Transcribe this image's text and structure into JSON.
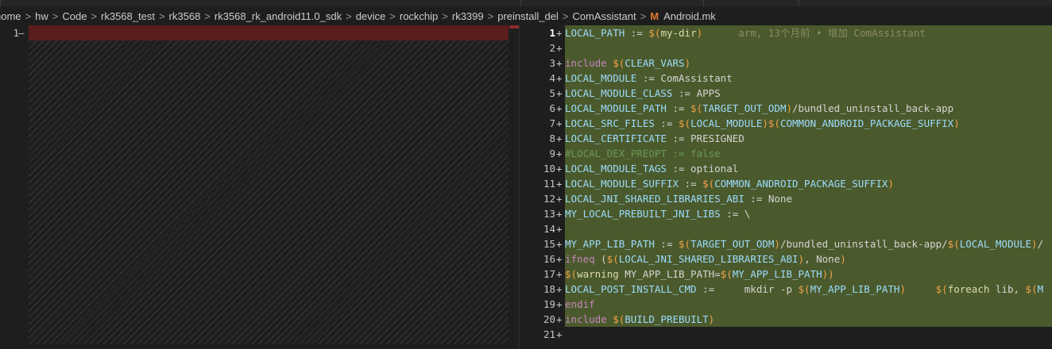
{
  "breadcrumb": {
    "items": [
      "home",
      "hw",
      "Code",
      "rk3568_test",
      "rk3568",
      "rk3568_rk_android11.0_sdk",
      "device",
      "rockchip",
      "rk3399",
      "preinstall_del",
      "ComAssistant"
    ],
    "file_icon": "M",
    "file_name": "Android.mk",
    "separator": ">"
  },
  "left": {
    "line_number": "1",
    "marker": "—"
  },
  "right": {
    "blame": "arm, 13个月前 • 增加 ComAssistant",
    "line_numbers": [
      "1",
      "2",
      "3",
      "4",
      "5",
      "6",
      "7",
      "8",
      "9",
      "10",
      "11",
      "12",
      "13",
      "14",
      "15",
      "16",
      "17",
      "18",
      "19",
      "20",
      "21"
    ],
    "plus": "+",
    "lines": [
      "LOCAL_PATH := $(my-dir)",
      "",
      "include $(CLEAR_VARS)",
      "LOCAL_MODULE := ComAssistant",
      "LOCAL_MODULE_CLASS := APPS",
      "LOCAL_MODULE_PATH := $(TARGET_OUT_ODM)/bundled_uninstall_back-app",
      "LOCAL_SRC_FILES := $(LOCAL_MODULE)$(COMMON_ANDROID_PACKAGE_SUFFIX)",
      "LOCAL_CERTIFICATE := PRESIGNED",
      "#LOCAL_DEX_PREOPT := false",
      "LOCAL_MODULE_TAGS := optional",
      "LOCAL_MODULE_SUFFIX := $(COMMON_ANDROID_PACKAGE_SUFFIX)",
      "LOCAL_JNI_SHARED_LIBRARIES_ABI := None",
      "MY_LOCAL_PREBUILT_JNI_LIBS := \\",
      "",
      "MY_APP_LIB_PATH := $(TARGET_OUT_ODM)/bundled_uninstall_back-app/$(LOCAL_MODULE)/",
      "ifneq ($(LOCAL_JNI_SHARED_LIBRARIES_ABI), None)",
      "$(warning MY_APP_LIB_PATH=$(MY_APP_LIB_PATH))",
      "LOCAL_POST_INSTALL_CMD :=     mkdir -p $(MY_APP_LIB_PATH)     $(foreach lib, $(M",
      "endif",
      "include $(BUILD_PREBUILT)",
      ""
    ]
  },
  "colors": {
    "editor_bg": "#1e1e1e",
    "inserted_bg": "#4b5a2c",
    "deleted_bg": "#5a1d1d",
    "variable": "#9cdcfe",
    "keyword": "#c586c0",
    "dollar": "#f0a14a",
    "comment": "#6a9955"
  }
}
